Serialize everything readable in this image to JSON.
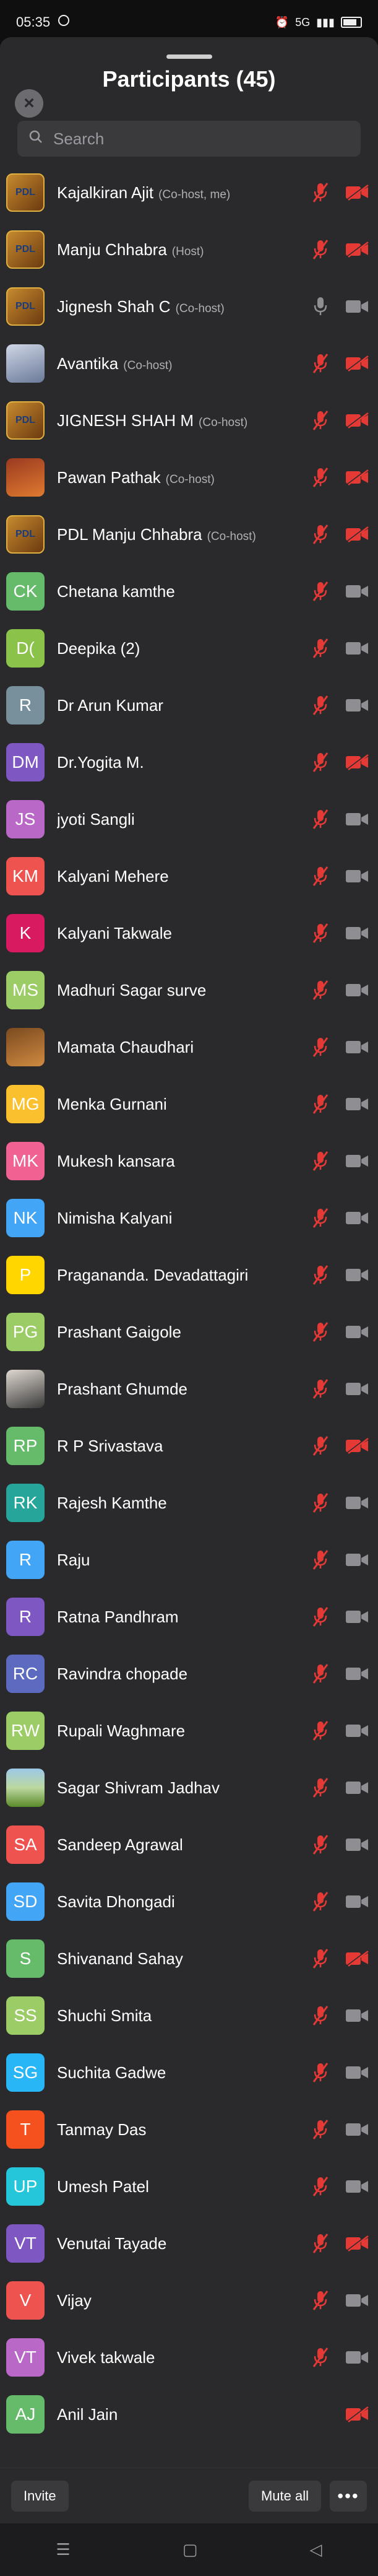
{
  "status_bar": {
    "time": "05:35",
    "right_text": "5G"
  },
  "title": "Participants (45)",
  "search": {
    "placeholder": "Search"
  },
  "participants": [
    {
      "name": "Kajalkiran Ajit",
      "role": "(Co-host, me)",
      "avatar": "PDL",
      "avatar_type": "photo",
      "mic": "muted",
      "cam": "off"
    },
    {
      "name": "Manju Chhabra",
      "role": "(Host)",
      "avatar": "PDL",
      "avatar_type": "photo",
      "mic": "muted",
      "cam": "off"
    },
    {
      "name": "Jignesh Shah C",
      "role": "(Co-host)",
      "avatar": "PDL",
      "avatar_type": "photo",
      "mic": "on",
      "cam": "on"
    },
    {
      "name": "Avantika",
      "role": "(Co-host)",
      "avatar": "",
      "avatar_type": "photo2",
      "mic": "muted",
      "cam": "off"
    },
    {
      "name": "JIGNESH SHAH M",
      "role": "(Co-host)",
      "avatar": "PDL",
      "avatar_type": "photo",
      "mic": "muted",
      "cam": "off"
    },
    {
      "name": "Pawan Pathak",
      "role": "(Co-host)",
      "avatar": "",
      "avatar_type": "photo3",
      "mic": "muted",
      "cam": "off"
    },
    {
      "name": "PDL Manju Chhabra",
      "role": "(Co-host)",
      "avatar": "PDL",
      "avatar_type": "photo",
      "mic": "muted",
      "cam": "off"
    },
    {
      "name": "Chetana kamthe",
      "role": "",
      "avatar": "CK",
      "color": "#66bb6a",
      "mic": "muted",
      "cam": "on"
    },
    {
      "name": "Deepika (2)",
      "role": "",
      "avatar": "D(",
      "color": "#8bc34a",
      "mic": "muted",
      "cam": "on"
    },
    {
      "name": "Dr Arun Kumar",
      "role": "",
      "avatar": "R",
      "color": "#78909c",
      "mic": "muted",
      "cam": "on"
    },
    {
      "name": "Dr.Yogita M.",
      "role": "",
      "avatar": "DM",
      "color": "#7e57c2",
      "mic": "muted",
      "cam": "off"
    },
    {
      "name": "jyoti Sangli",
      "role": "",
      "avatar": "JS",
      "color": "#ba68c8",
      "mic": "muted",
      "cam": "on"
    },
    {
      "name": "Kalyani Mehere",
      "role": "",
      "avatar": "KM",
      "color": "#ef5350",
      "mic": "muted",
      "cam": "on"
    },
    {
      "name": "Kalyani Takwale",
      "role": "",
      "avatar": "K",
      "color": "#d81b60",
      "mic": "muted",
      "cam": "on"
    },
    {
      "name": "Madhuri Sagar surve",
      "role": "",
      "avatar": "MS",
      "color": "#9ccc65",
      "mic": "muted",
      "cam": "on"
    },
    {
      "name": "Mamata Chaudhari",
      "role": "",
      "avatar": "",
      "avatar_type": "photo4",
      "mic": "muted",
      "cam": "on"
    },
    {
      "name": "Menka Gurnani",
      "role": "",
      "avatar": "MG",
      "color": "#fbc02d",
      "mic": "muted",
      "cam": "on"
    },
    {
      "name": "Mukesh kansara",
      "role": "",
      "avatar": "MK",
      "color": "#f06292",
      "mic": "muted",
      "cam": "on"
    },
    {
      "name": "Nimisha Kalyani",
      "role": "",
      "avatar": "NK",
      "color": "#42a5f5",
      "mic": "muted",
      "cam": "on"
    },
    {
      "name": "Praganandа.   Devadattagiri",
      "role": "",
      "avatar": "P",
      "color": "#ffd600",
      "mic": "muted",
      "cam": "on"
    },
    {
      "name": "Prashant Gaigole",
      "role": "",
      "avatar": "PG",
      "color": "#9ccc65",
      "mic": "muted",
      "cam": "on"
    },
    {
      "name": "Prashant Ghumde",
      "role": "",
      "avatar": "",
      "avatar_type": "photo5",
      "mic": "muted",
      "cam": "on"
    },
    {
      "name": "R P Srivastava",
      "role": "",
      "avatar": "RP",
      "color": "#66bb6a",
      "mic": "muted",
      "cam": "off"
    },
    {
      "name": "Rajesh Kamthe",
      "role": "",
      "avatar": "RK",
      "color": "#26a69a",
      "mic": "muted",
      "cam": "on"
    },
    {
      "name": "Raju",
      "role": "",
      "avatar": "R",
      "color": "#42a5f5",
      "mic": "muted",
      "cam": "on"
    },
    {
      "name": "Ratna Pandhram",
      "role": "",
      "avatar": "R",
      "color": "#7e57c2",
      "mic": "muted",
      "cam": "on"
    },
    {
      "name": "Ravindra chopade",
      "role": "",
      "avatar": "RC",
      "color": "#5c6bc0",
      "mic": "muted",
      "cam": "on"
    },
    {
      "name": "Rupali Waghmare",
      "role": "",
      "avatar": "RW",
      "color": "#9ccc65",
      "mic": "muted",
      "cam": "on"
    },
    {
      "name": "Sagar Shivram Jadhav",
      "role": "",
      "avatar": "",
      "avatar_type": "photo6",
      "mic": "muted",
      "cam": "on"
    },
    {
      "name": "Sandeep Agrawal",
      "role": "",
      "avatar": "SA",
      "color": "#ef5350",
      "mic": "muted",
      "cam": "on"
    },
    {
      "name": "Savita Dhongadi",
      "role": "",
      "avatar": "SD",
      "color": "#42a5f5",
      "mic": "muted",
      "cam": "on"
    },
    {
      "name": "Shivanand  Sahay",
      "role": "",
      "avatar": "S",
      "color": "#66bb6a",
      "mic": "muted",
      "cam": "off"
    },
    {
      "name": "Shuchi Smita",
      "role": "",
      "avatar": "SS",
      "color": "#9ccc65",
      "mic": "muted",
      "cam": "on"
    },
    {
      "name": "Suchita Gadwe",
      "role": "",
      "avatar": "SG",
      "color": "#29b6f6",
      "mic": "muted",
      "cam": "on"
    },
    {
      "name": "Tanmay Das",
      "role": "",
      "avatar": "T",
      "color": "#f4511e",
      "mic": "muted",
      "cam": "on"
    },
    {
      "name": "Umesh Patel",
      "role": "",
      "avatar": "UP",
      "color": "#26c6da",
      "mic": "muted",
      "cam": "on"
    },
    {
      "name": "Venutai Tayade",
      "role": "",
      "avatar": "VT",
      "color": "#7e57c2",
      "mic": "muted",
      "cam": "off"
    },
    {
      "name": "Vijay",
      "role": "",
      "avatar": "V",
      "color": "#ef5350",
      "mic": "muted",
      "cam": "on"
    },
    {
      "name": "Vivek takwale",
      "role": "",
      "avatar": "VT",
      "color": "#ba68c8",
      "mic": "muted",
      "cam": "on"
    },
    {
      "name": "Anil Jain",
      "role": "",
      "avatar": "AJ",
      "color": "#66bb6a",
      "mic": "none",
      "cam": "off"
    }
  ],
  "footer": {
    "invite_label": "Invite",
    "mute_all_label": "Mute all",
    "more_label": "•••"
  },
  "colors": {
    "muted_red": "#e53935",
    "icon_gray": "#8e8e93"
  }
}
